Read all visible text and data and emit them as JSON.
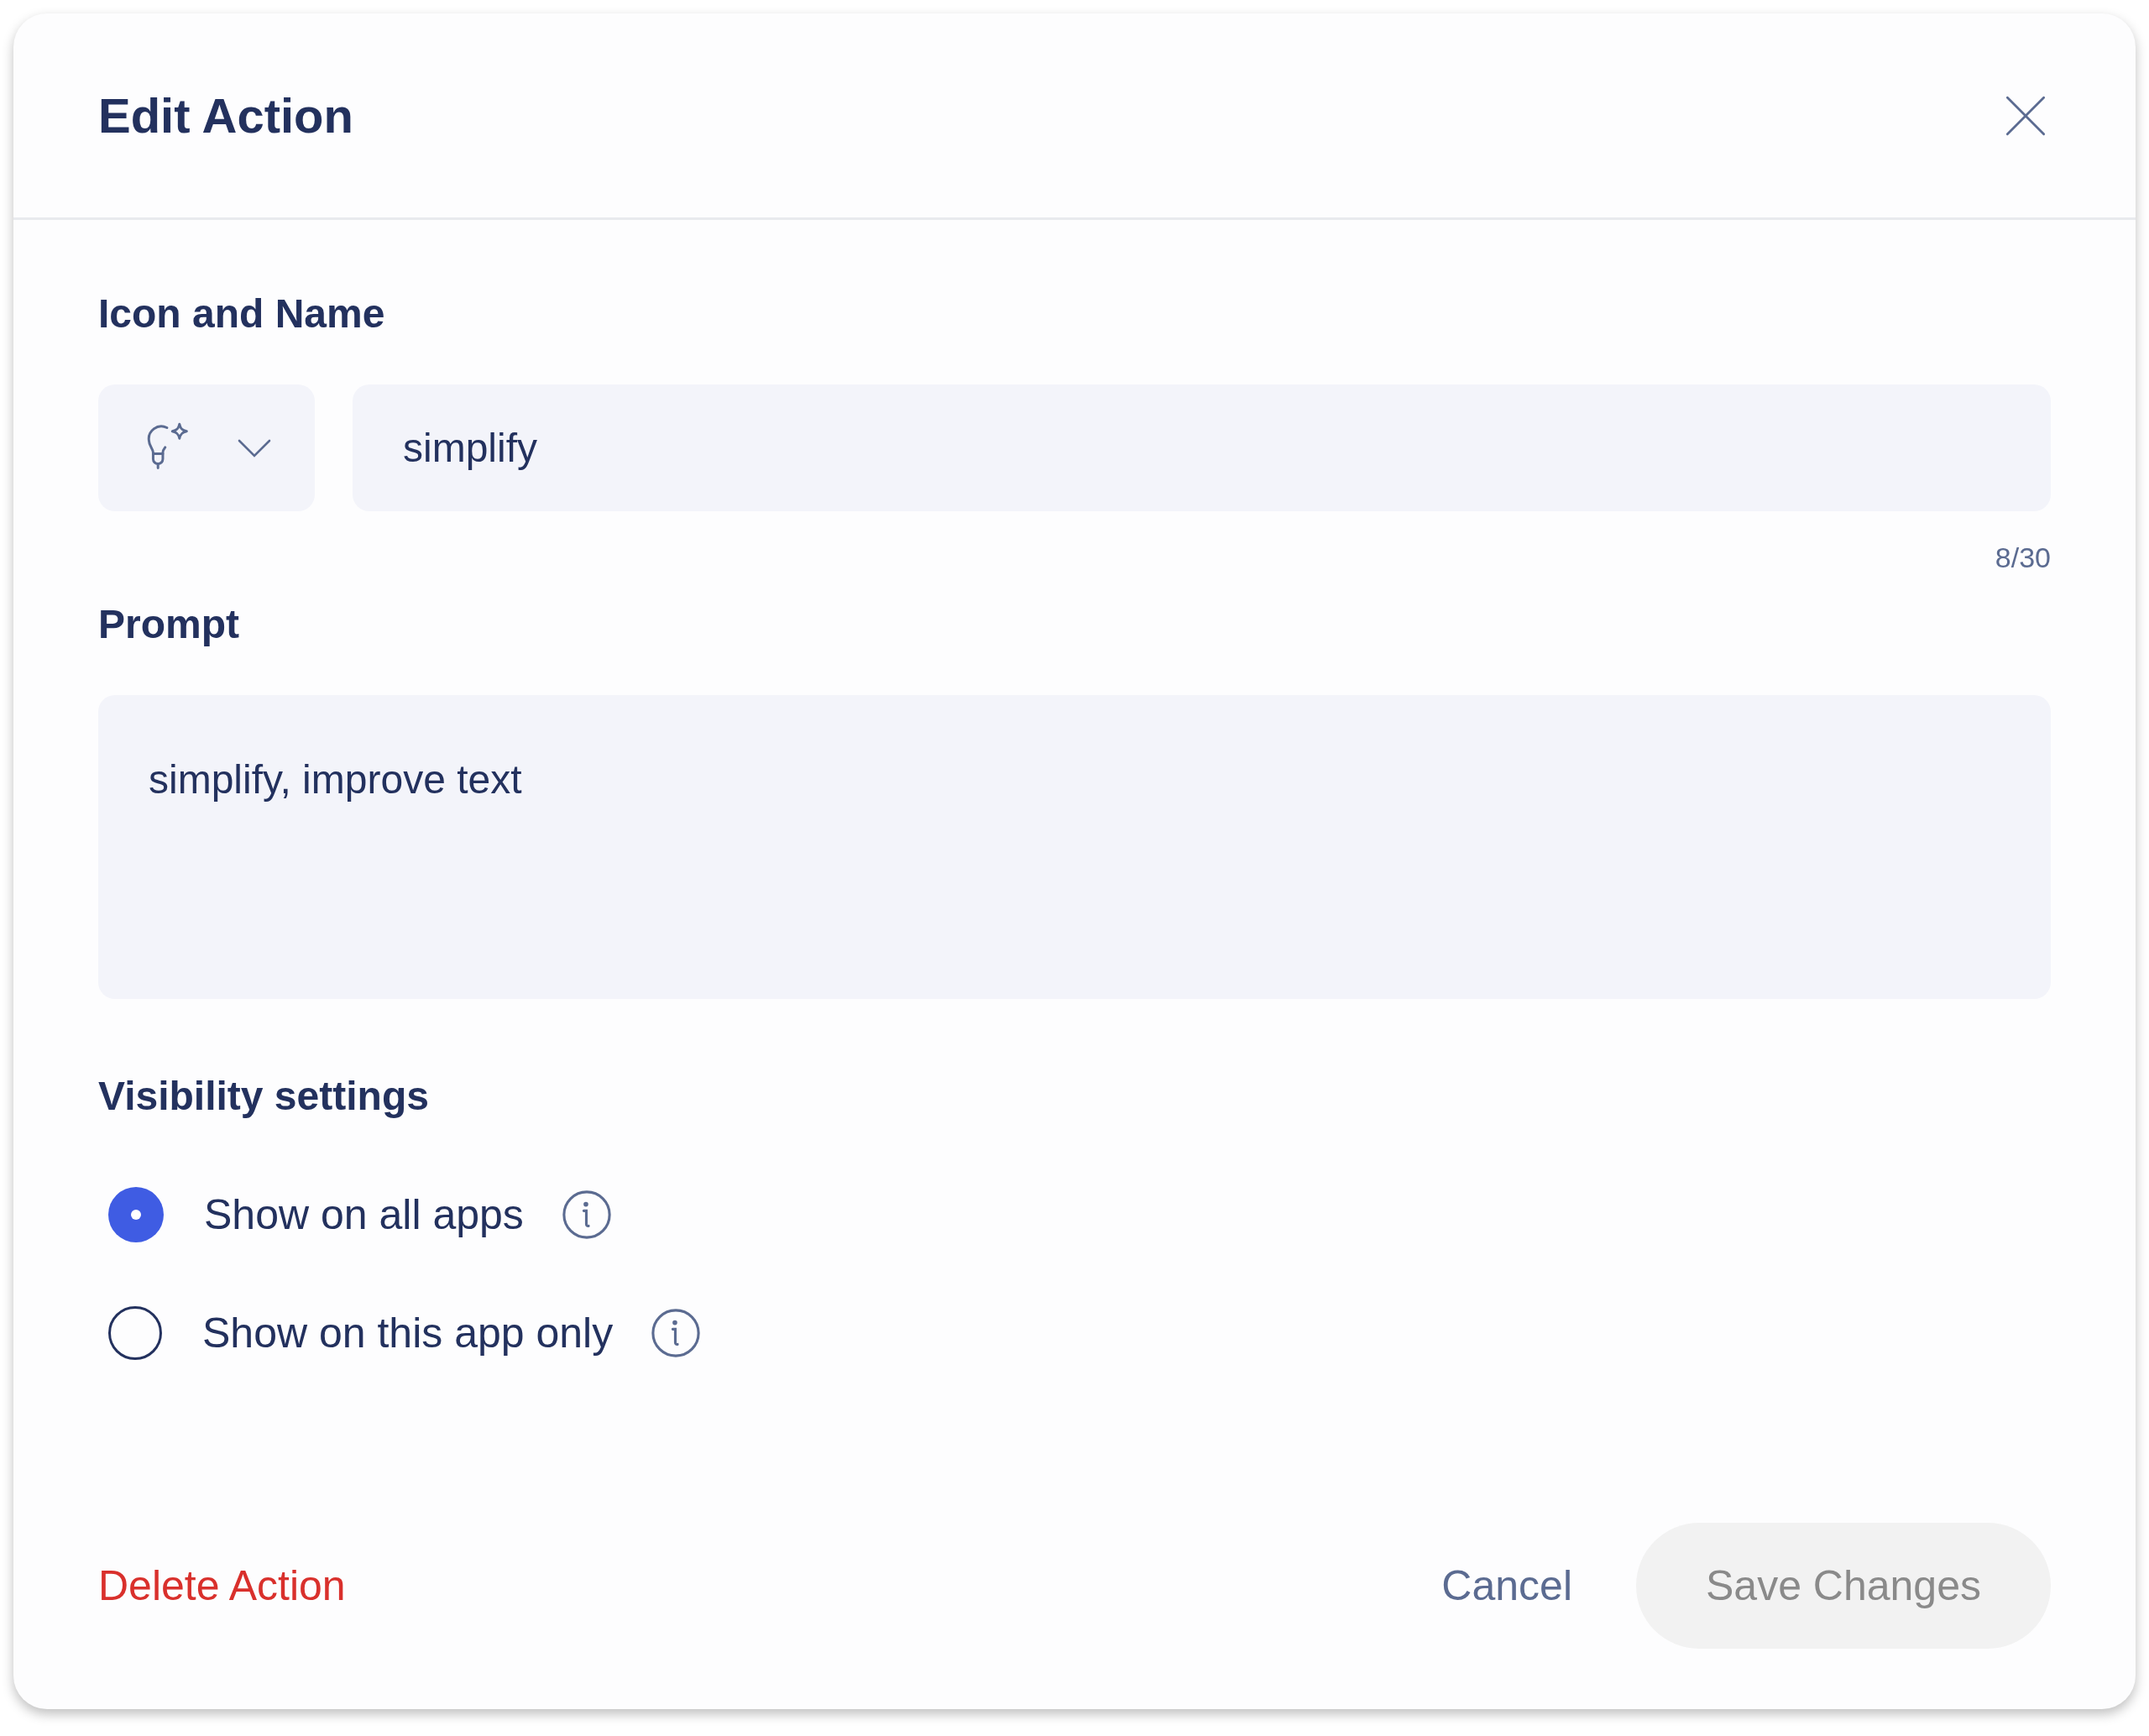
{
  "dialog": {
    "title": "Edit Action"
  },
  "icon_and_name": {
    "heading": "Icon and Name",
    "name_value": "simplify",
    "counter": "8/30"
  },
  "prompt": {
    "heading": "Prompt",
    "value": "simplify, improve text"
  },
  "visibility": {
    "heading": "Visibility settings",
    "options": [
      {
        "label": "Show on all apps",
        "selected": true
      },
      {
        "label": "Show on this app only",
        "selected": false
      }
    ]
  },
  "footer": {
    "delete_label": "Delete Action",
    "cancel_label": "Cancel",
    "save": {
      "label": "Save Changes",
      "disabled": true
    }
  }
}
